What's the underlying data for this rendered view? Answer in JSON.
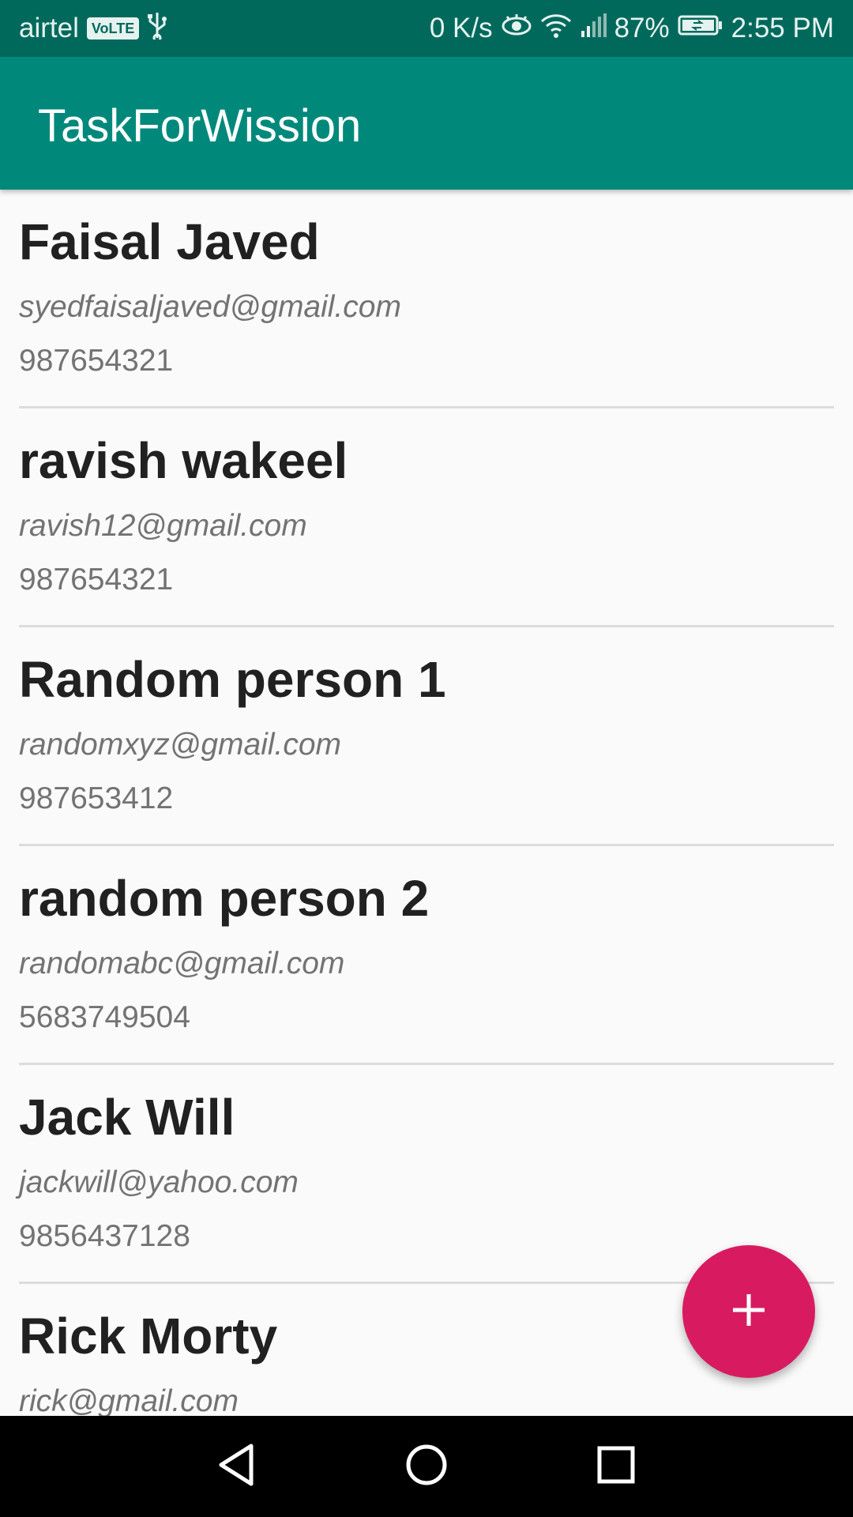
{
  "status_bar": {
    "carrier": "airtel",
    "volte": "VoLTE",
    "speed": "0 K/s",
    "battery": "87%",
    "time": "2:55 PM"
  },
  "app_bar": {
    "title": "TaskForWission"
  },
  "contacts": [
    {
      "name": "Faisal Javed",
      "email": "syedfaisaljaved@gmail.com",
      "phone": "987654321"
    },
    {
      "name": "ravish wakeel",
      "email": "ravish12@gmail.com",
      "phone": "987654321"
    },
    {
      "name": "Random person 1",
      "email": "randomxyz@gmail.com",
      "phone": "987653412"
    },
    {
      "name": "random person 2",
      "email": "randomabc@gmail.com",
      "phone": "5683749504"
    },
    {
      "name": "Jack Will",
      "email": "jackwill@yahoo.com",
      "phone": "9856437128"
    },
    {
      "name": "Rick Morty",
      "email": "rick@gmail.com",
      "phone": ""
    }
  ],
  "fab": {
    "icon": "plus-icon",
    "color": "#d81b60"
  },
  "colors": {
    "primary": "#00897b",
    "primary_dark": "#00695c",
    "accent": "#d81b60"
  },
  "nav_bar": {
    "icons": [
      "back-icon",
      "home-icon",
      "recents-icon"
    ]
  }
}
